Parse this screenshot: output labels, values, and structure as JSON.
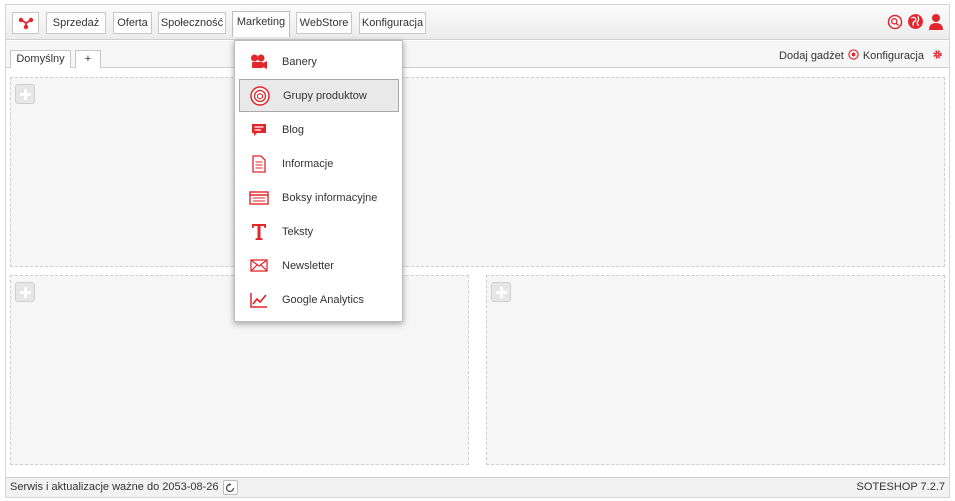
{
  "nav": {
    "logo_icon": "soteshop-logo-icon",
    "items": [
      "Sprzedaż",
      "Oferta",
      "Społeczność",
      "Marketing",
      "WebStore",
      "Konfiguracja"
    ],
    "active": "Marketing",
    "right_icons": [
      "search-icon",
      "globe-icon",
      "user-icon"
    ]
  },
  "tabs": {
    "items": [
      "Domyślny",
      "+"
    ],
    "active": "Domyślny"
  },
  "tab_actions": {
    "add_gadget": "Dodaj gadżet",
    "config": "Konfiguracja"
  },
  "dropdown": {
    "items": [
      {
        "label": "Banery",
        "icon": "camera-icon"
      },
      {
        "label": "Grupy produktow",
        "icon": "product-group-icon"
      },
      {
        "label": "Blog",
        "icon": "speech-bubble-icon"
      },
      {
        "label": "Informacje",
        "icon": "document-icon"
      },
      {
        "label": "Boksy informacyjne",
        "icon": "info-box-icon"
      },
      {
        "label": "Teksty",
        "icon": "text-icon"
      },
      {
        "label": "Newsletter",
        "icon": "envelope-icon"
      },
      {
        "label": "Google Analytics",
        "icon": "chart-line-icon"
      }
    ],
    "highlighted": "Grupy produktow"
  },
  "footer": {
    "service_text": "Serwis i aktualizacje ważne do 2053-08-26",
    "version": "SOTESHOP 7.2.7"
  },
  "colors": {
    "accent": "#e2262c",
    "border": "#cfcfcf",
    "panel_bg": "#f6f6f6"
  }
}
